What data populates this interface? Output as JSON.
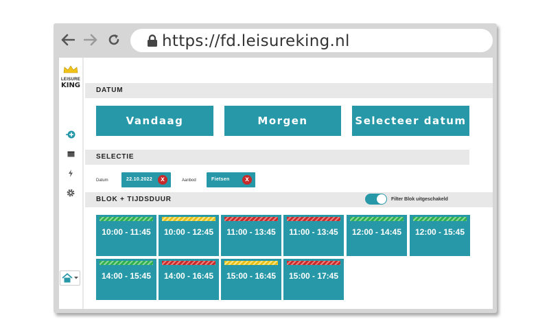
{
  "browser": {
    "url": "https://fd.leisureking.nl"
  },
  "logo": {
    "small": "LEISURE",
    "big": "KING"
  },
  "sections": {
    "datum": "DATUM",
    "selectie": "SELECTIE",
    "blok": "BLOK + TIJDSDUUR"
  },
  "date_buttons": {
    "today": "Vandaag",
    "tomorrow": "Morgen",
    "select": "Selecteer datum"
  },
  "selection": {
    "datum_label": "Datum",
    "datum_value": "22.10.2022",
    "aanbod_label": "Aanbod",
    "aanbod_value": "Fietsen",
    "remove_symbol": "x"
  },
  "filter": {
    "label": "Filter Blok uitgeschakeld",
    "enabled": true
  },
  "slots": [
    {
      "time": "10:00 - 11:45",
      "availability": "green"
    },
    {
      "time": "10:00 - 12:45",
      "availability": "yellow"
    },
    {
      "time": "11:00 - 13:45",
      "availability": "red"
    },
    {
      "time": "11:00 - 13:45",
      "availability": "red"
    },
    {
      "time": "12:00 - 14:45",
      "availability": "green"
    },
    {
      "time": "12:00 - 15:45",
      "availability": "green"
    },
    {
      "time": "14:00 - 15:45",
      "availability": "green"
    },
    {
      "time": "14:00 - 16:45",
      "availability": "red"
    },
    {
      "time": "15:00 - 16:45",
      "availability": "yellow"
    },
    {
      "time": "15:00 - 17:45",
      "availability": "red"
    }
  ],
  "colors": {
    "accent": "#2698a8",
    "remove": "#c62a2a",
    "status_green": "#2fb24c",
    "status_yellow": "#e8c01a",
    "status_red": "#c92a2a"
  }
}
